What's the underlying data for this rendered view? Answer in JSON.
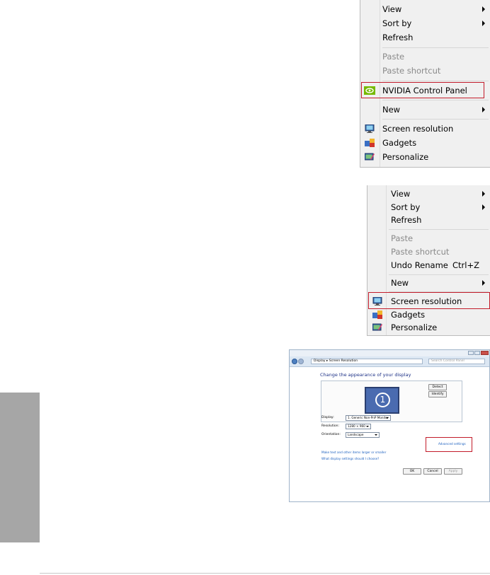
{
  "menu1": {
    "items": [
      {
        "label": "View",
        "submenu": true
      },
      {
        "label": "Sort by",
        "submenu": true
      },
      {
        "label": "Refresh"
      },
      {
        "label": "Paste",
        "disabled": true
      },
      {
        "label": "Paste shortcut",
        "disabled": true
      },
      {
        "label": "NVIDIA Control Panel",
        "icon": "nvidia-icon",
        "highlighted": true
      },
      {
        "label": "New",
        "submenu": true
      },
      {
        "label": "Screen resolution",
        "icon": "screen-resolution-icon"
      },
      {
        "label": "Gadgets",
        "icon": "gadgets-icon"
      },
      {
        "label": "Personalize",
        "icon": "personalize-icon"
      }
    ]
  },
  "menu2": {
    "items": [
      {
        "label": "View",
        "submenu": true
      },
      {
        "label": "Sort by",
        "submenu": true
      },
      {
        "label": "Refresh"
      },
      {
        "label": "Paste",
        "disabled": true
      },
      {
        "label": "Paste shortcut",
        "disabled": true
      },
      {
        "label": "Undo Rename",
        "shortcut": "Ctrl+Z"
      },
      {
        "label": "New",
        "submenu": true
      },
      {
        "label": "Screen resolution",
        "icon": "screen-resolution-icon",
        "highlighted": true
      },
      {
        "label": "Gadgets",
        "icon": "gadgets-icon"
      },
      {
        "label": "Personalize",
        "icon": "personalize-icon"
      }
    ]
  },
  "window": {
    "breadcrumb": "Display ▸ Screen Resolution",
    "search_placeholder": "Search Control Panel",
    "heading": "Change the appearance of your display",
    "monitor_number": "1",
    "detect_label": "Detect",
    "identify_label": "Identify",
    "display_label": "Display:",
    "display_value": "1. Generic Non-PnP Monitor",
    "resolution_label": "Resolution:",
    "resolution_value": "1280 × 960",
    "orientation_label": "Orientation:",
    "orientation_value": "Landscape",
    "advanced_link": "Advanced settings",
    "link_text_size": "Make text and other items larger or smaller",
    "link_what_settings": "What display settings should I choose?",
    "ok_label": "OK",
    "cancel_label": "Cancel",
    "apply_label": "Apply"
  },
  "colors": {
    "highlight_border": "#c21b2a",
    "menu_background": "#f0f0f0",
    "side_tab": "#a6a6a6",
    "link": "#1b5fbf",
    "heading": "#1e3287"
  }
}
